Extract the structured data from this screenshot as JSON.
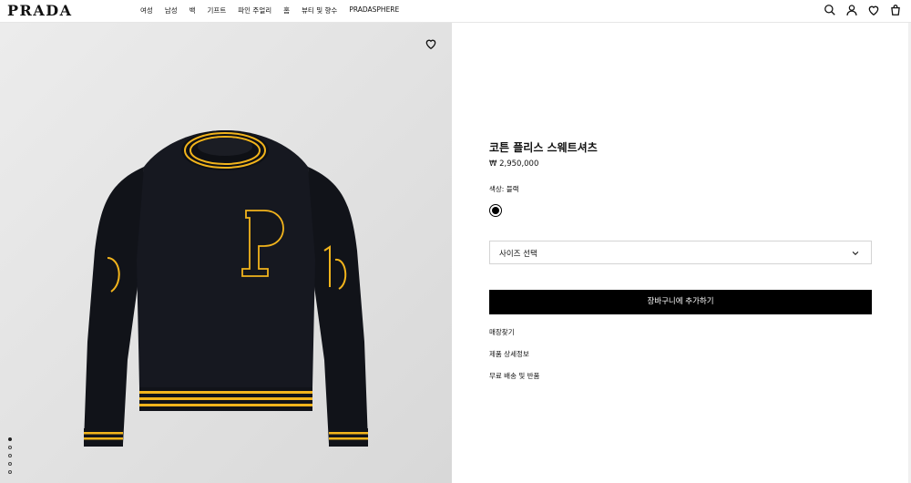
{
  "header": {
    "logo": "PRADA",
    "nav": [
      "여성",
      "남성",
      "백",
      "기프트",
      "파인 주얼리",
      "홈",
      "뷰티 및 향수",
      "PRADASPHERE"
    ]
  },
  "product": {
    "title": "코튼 플리스 스웨트셔츠",
    "price": "₩ 2,950,000",
    "color_label": "색상: 블랙",
    "size_placeholder": "사이즈 선택",
    "add_to_cart": "장바구니에 추가하기",
    "links": [
      "매장찾기",
      "제품 상세정보",
      "무료 배송 및 반품"
    ]
  },
  "gallery": {
    "image_count": 5,
    "active_index": 0
  },
  "colors": {
    "swatch": "#000000",
    "button": "#000000",
    "trim": "#f2b41c"
  }
}
